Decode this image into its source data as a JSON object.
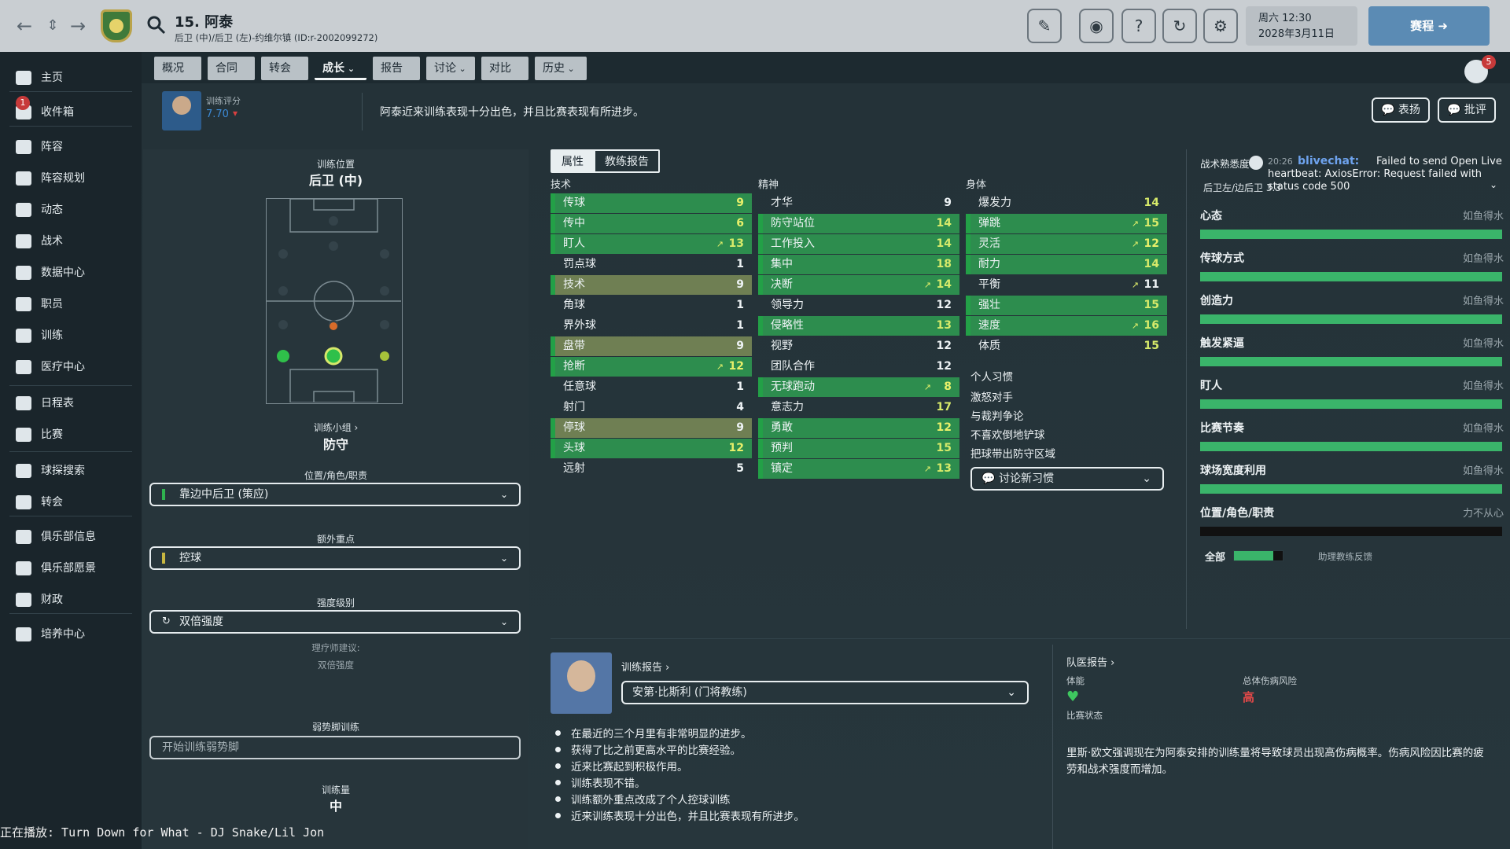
{
  "header": {
    "title": "15. 阿泰",
    "subtitle": "后卫 (中)/后卫 (左)-约维尔镇 (ID:r-2002099272)",
    "date_line1": "周六 12:30",
    "date_line2": "2028年3月11日",
    "continue_label": "赛程"
  },
  "sidebar": {
    "items": [
      {
        "label": "主页",
        "icon": "home-icon"
      },
      {
        "label": "收件箱",
        "icon": "inbox-icon",
        "badge": "1"
      },
      {
        "label": "阵容",
        "icon": "shirt-icon"
      },
      {
        "label": "阵容规划",
        "icon": "clipboard-icon"
      },
      {
        "label": "动态",
        "icon": "dynamics-icon"
      },
      {
        "label": "战术",
        "icon": "tactics-icon"
      },
      {
        "label": "数据中心",
        "icon": "data-icon"
      },
      {
        "label": "职员",
        "icon": "staff-icon"
      },
      {
        "label": "训练",
        "icon": "training-icon"
      },
      {
        "label": "医疗中心",
        "icon": "medical-icon"
      },
      {
        "label": "日程表",
        "icon": "calendar-icon"
      },
      {
        "label": "比赛",
        "icon": "trophy-icon"
      },
      {
        "label": "球探搜索",
        "icon": "scout-icon"
      },
      {
        "label": "转会",
        "icon": "transfer-icon"
      },
      {
        "label": "俱乐部信息",
        "icon": "club-icon"
      },
      {
        "label": "俱乐部愿景",
        "icon": "vision-icon"
      },
      {
        "label": "财政",
        "icon": "finance-icon"
      },
      {
        "label": "培养中心",
        "icon": "development-icon"
      }
    ]
  },
  "tabs": [
    "概况",
    "合同",
    "转会",
    "成长",
    "报告",
    "讨论",
    "对比",
    "历史"
  ],
  "active_tab": "成长",
  "notif_count": "5",
  "rating": {
    "label": "训练评分",
    "value": "7.70"
  },
  "summary_text": "阿泰近来训练表现十分出色，并且比赛表现有所进步。",
  "praise_label": "表扬",
  "criticize_label": "批评",
  "left": {
    "position_label": "训练位置",
    "position_value": "后卫 (中)",
    "group_label": "训练小组 ›",
    "group_value": "防守",
    "role_label": "位置/角色/职责",
    "role_value": "靠边中后卫 (策应)",
    "extra_label": "额外重点",
    "extra_value": "控球",
    "intensity_label": "强度级别",
    "intensity_value": "双倍强度",
    "physio_advice_label": "理疗师建议:",
    "physio_advice_value": "双倍强度",
    "weakfoot_label": "弱势脚训练",
    "weakfoot_value": "开始训练弱势脚",
    "volume_label": "训练量",
    "volume_value": "中"
  },
  "attr_tabs": [
    "属性",
    "教练报告"
  ],
  "technical": {
    "heading": "技术",
    "items": [
      {
        "name": "传球",
        "value": "9",
        "hl": "green",
        "arrow": ""
      },
      {
        "name": "传中",
        "value": "6",
        "hl": "green",
        "arrow": ""
      },
      {
        "name": "盯人",
        "value": "13",
        "hl": "green",
        "arrow": "↗"
      },
      {
        "name": "罚点球",
        "value": "1",
        "hl": "",
        "arrow": ""
      },
      {
        "name": "技术",
        "value": "9",
        "hl": "olive",
        "arrow": ""
      },
      {
        "name": "角球",
        "value": "1",
        "hl": "",
        "arrow": ""
      },
      {
        "name": "界外球",
        "value": "1",
        "hl": "",
        "arrow": ""
      },
      {
        "name": "盘带",
        "value": "9",
        "hl": "olive",
        "arrow": ""
      },
      {
        "name": "抢断",
        "value": "12",
        "hl": "green",
        "arrow": "↗"
      },
      {
        "name": "任意球",
        "value": "1",
        "hl": "",
        "arrow": ""
      },
      {
        "name": "射门",
        "value": "4",
        "hl": "",
        "arrow": ""
      },
      {
        "name": "停球",
        "value": "9",
        "hl": "olive",
        "arrow": ""
      },
      {
        "name": "头球",
        "value": "12",
        "hl": "green",
        "arrow": ""
      },
      {
        "name": "远射",
        "value": "5",
        "hl": "",
        "arrow": ""
      }
    ]
  },
  "mental": {
    "heading": "精神",
    "items": [
      {
        "name": "才华",
        "value": "9",
        "hl": "",
        "arrow": ""
      },
      {
        "name": "防守站位",
        "value": "14",
        "hl": "green",
        "arrow": ""
      },
      {
        "name": "工作投入",
        "value": "14",
        "hl": "green",
        "arrow": ""
      },
      {
        "name": "集中",
        "value": "18",
        "hl": "green",
        "arrow": ""
      },
      {
        "name": "决断",
        "value": "14",
        "hl": "green",
        "arrow": "↗"
      },
      {
        "name": "领导力",
        "value": "12",
        "hl": "",
        "arrow": ""
      },
      {
        "name": "侵略性",
        "value": "13",
        "hl": "green",
        "arrow": ""
      },
      {
        "name": "视野",
        "value": "12",
        "hl": "",
        "arrow": ""
      },
      {
        "name": "团队合作",
        "value": "12",
        "hl": "",
        "arrow": ""
      },
      {
        "name": "无球跑动",
        "value": "8",
        "hl": "green",
        "arrow": "↗"
      },
      {
        "name": "意志力",
        "value": "17",
        "hl": "",
        "arrow": ""
      },
      {
        "name": "勇敢",
        "value": "12",
        "hl": "green",
        "arrow": ""
      },
      {
        "name": "预判",
        "value": "15",
        "hl": "green",
        "arrow": ""
      },
      {
        "name": "镇定",
        "value": "13",
        "hl": "green",
        "arrow": "↗"
      }
    ]
  },
  "physical": {
    "heading": "身体",
    "items": [
      {
        "name": "爆发力",
        "value": "14",
        "hl": "",
        "arrow": ""
      },
      {
        "name": "弹跳",
        "value": "15",
        "hl": "green",
        "arrow": "↗"
      },
      {
        "name": "灵活",
        "value": "12",
        "hl": "green",
        "arrow": "↗"
      },
      {
        "name": "耐力",
        "value": "14",
        "hl": "green",
        "arrow": ""
      },
      {
        "name": "平衡",
        "value": "11",
        "hl": "",
        "arrow": "↗"
      },
      {
        "name": "强壮",
        "value": "15",
        "hl": "green",
        "arrow": ""
      },
      {
        "name": "速度",
        "value": "16",
        "hl": "green",
        "arrow": "↗"
      },
      {
        "name": "体质",
        "value": "15",
        "hl": "",
        "arrow": ""
      }
    ]
  },
  "habits": {
    "heading": "个人习惯",
    "items": [
      "激怒对手",
      "与裁判争论",
      "不喜欢倒地铲球",
      "把球带出防守区域"
    ],
    "discuss_label": "讨论新习惯"
  },
  "familiarity": {
    "header": "战术熟悉度",
    "chat_time": "20:26",
    "chat_user": "blivechat:",
    "chat_msg": "Failed to send Open Live heartbeat: AxiosError: Request failed with status code 500",
    "role_line": "后卫左/边后卫 3.3",
    "rows": [
      {
        "label": "心态",
        "value": "如鱼得水",
        "level": 1.0
      },
      {
        "label": "传球方式",
        "value": "如鱼得水",
        "level": 1.0
      },
      {
        "label": "创造力",
        "value": "如鱼得水",
        "level": 1.0
      },
      {
        "label": "触发紧逼",
        "value": "如鱼得水",
        "level": 1.0
      },
      {
        "label": "盯人",
        "value": "如鱼得水",
        "level": 1.0
      },
      {
        "label": "比赛节奏",
        "value": "如鱼得水",
        "level": 1.0
      },
      {
        "label": "球场宽度利用",
        "value": "如鱼得水",
        "level": 1.0
      },
      {
        "label": "位置/角色/职责",
        "value": "力不从心",
        "level": 0.0
      }
    ],
    "overall_label": "全部",
    "overall_level": 0.8,
    "assist_label": "助理教练反馈"
  },
  "coach_report": {
    "heading": "训练报告 ›",
    "coach": "安第·比斯利 (门将教练)",
    "bullets": [
      "在最近的三个月里有非常明显的进步。",
      "获得了比之前更高水平的比赛经验。",
      "近来比赛起到积极作用。",
      "训练表现不错。",
      "训练额外重点改成了个人控球训练",
      "近来训练表现十分出色，并且比赛表现有所进步。"
    ]
  },
  "medical": {
    "heading": "队医报告 ›",
    "fitness_label": "体能",
    "condition_label": "比赛状态",
    "injury_risk_label": "总体伤病风险",
    "injury_risk_value": "高",
    "risk_color": "#e24848",
    "text": "里斯·欧文强调现在为阿泰安排的训练量将导致球员出现高伤病概率。伤病风险因比赛的疲劳和战术强度而增加。"
  },
  "now_playing": "正在播放: Turn Down for What - DJ Snake/Lil Jon"
}
